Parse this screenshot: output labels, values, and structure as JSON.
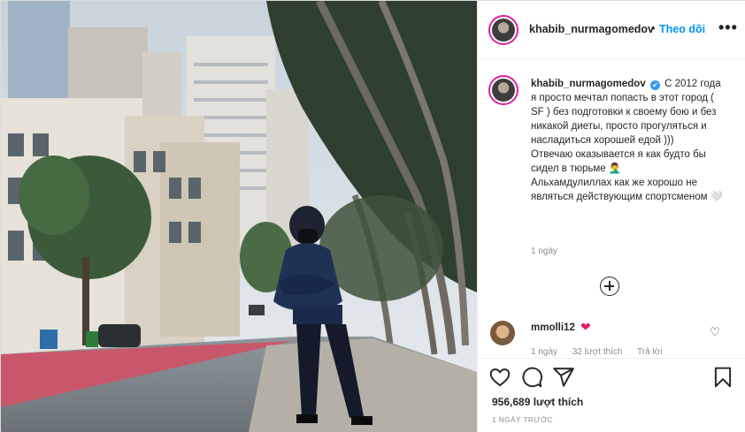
{
  "post": {
    "header": {
      "username": "khabib_nurmagomedov",
      "separator": "•",
      "follow_label": "Theo dõi",
      "more_icon": "more-horizontal-icon"
    },
    "caption": {
      "username": "khabib_nurmagomedov",
      "verified_mark": "✔",
      "line1": "С 2012 года я просто мечтал попасть в этот город ( SF ) без подготовки к своему бою и без никакой диеты, просто прогуляться и насладиться хорошей едой )))",
      "line2": "Отвечаю оказывается я как будто бы сидел в тюрьме 🤦‍♂️",
      "line3": "Альхамдулиллах как же хорошо не являться действующим спортсменом 🤍",
      "time": "1 ngày"
    },
    "comment": {
      "username": "mmolli12",
      "emoji": "❤",
      "time": "1 ngày",
      "likes": "32 lượt thích",
      "reply": "Trả lời"
    },
    "actions": {
      "like_icon": "heart-icon",
      "comment_icon": "comment-icon",
      "share_icon": "share-icon",
      "save_icon": "bookmark-icon",
      "likes_text": "956,689 lượt thích",
      "posted_ago": "1 NGÀY TRƯỚC"
    },
    "colors": {
      "accent": "#0095f6",
      "heart": "#e0245e",
      "text": "#262626",
      "muted": "#8e8e8e"
    }
  }
}
